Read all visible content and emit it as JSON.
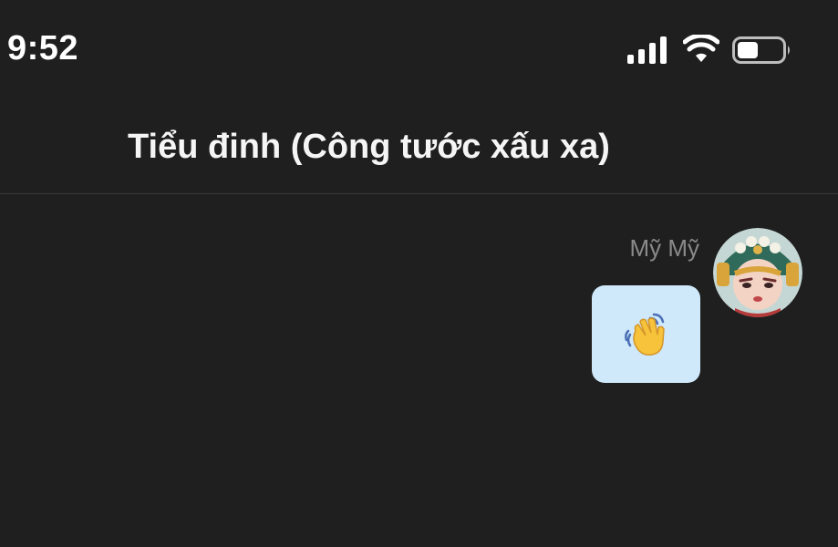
{
  "status_bar": {
    "time": "9:52",
    "signal_icon": "cellular-signal-icon",
    "wifi_icon": "wifi-icon",
    "battery_icon": "battery-icon"
  },
  "header": {
    "title": "Tiểu đinh (Công tước xấu xa)"
  },
  "messages": [
    {
      "sender": "Mỹ Mỹ",
      "avatar_icon": "avatar-icon",
      "content_icon": "waving-hand-icon",
      "bubble_color": "#cfe9fb"
    }
  ],
  "colors": {
    "background": "#1f1f1f",
    "title_text": "#f5f5f5",
    "sender_text": "#8a8a8a",
    "divider": "#3a3a3a"
  }
}
